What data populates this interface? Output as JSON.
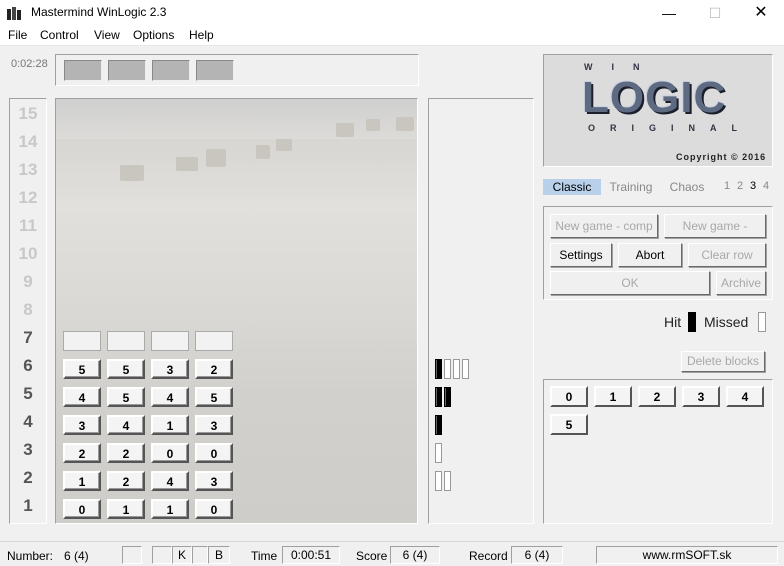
{
  "window": {
    "title": "Mastermind WinLogic 2.3",
    "minimize": "—",
    "maximize": "☐",
    "close": "✕"
  },
  "menu": [
    "File",
    "Control",
    "View",
    "Options",
    "Help"
  ],
  "timer": "0:02:28",
  "row_numbers": [
    "15",
    "14",
    "13",
    "12",
    "11",
    "10",
    "9",
    "8",
    "7",
    "6",
    "5",
    "4",
    "3",
    "2",
    "1"
  ],
  "active_rows": [
    "7",
    "6",
    "5",
    "4",
    "3",
    "2",
    "1"
  ],
  "guesses": [
    {
      "row": "6",
      "pegs": [
        "5",
        "5",
        "3",
        "2"
      ],
      "hits": 1,
      "missed": 3
    },
    {
      "row": "5",
      "pegs": [
        "4",
        "5",
        "4",
        "5"
      ],
      "hits": 2,
      "missed": 0
    },
    {
      "row": "4",
      "pegs": [
        "3",
        "4",
        "1",
        "3"
      ],
      "hits": 1,
      "missed": 0
    },
    {
      "row": "3",
      "pegs": [
        "2",
        "2",
        "0",
        "0"
      ],
      "hits": 0,
      "missed": 1
    },
    {
      "row": "2",
      "pegs": [
        "1",
        "2",
        "4",
        "3"
      ],
      "hits": 0,
      "missed": 2
    },
    {
      "row": "1",
      "pegs": [
        "0",
        "1",
        "1",
        "0"
      ],
      "hits": 0,
      "missed": 0
    }
  ],
  "logo": {
    "win": "WIN",
    "main": "LOGIC",
    "original": "ORIGINAL",
    "copyright": "Copyright © 2016"
  },
  "modes": {
    "classic": "Classic",
    "training": "Training",
    "chaos": "Chaos",
    "levels": [
      "1",
      "2",
      "3",
      "4"
    ],
    "selected_level": "3"
  },
  "controls": {
    "new_game_comp": "New game - comp",
    "new_game_player": "New game - player",
    "settings": "Settings",
    "abort": "Abort",
    "clear_row": "Clear row",
    "ok": "OK",
    "archive": "Archive",
    "delete_blocks": "Delete blocks"
  },
  "legend": {
    "hit": "Hit",
    "missed": "Missed"
  },
  "digits": [
    "0",
    "1",
    "2",
    "3",
    "4",
    "5"
  ],
  "status": {
    "number_label": "Number:",
    "number_value": "6 (4)",
    "k_label": "K",
    "b_label": "B",
    "time_label": "Time",
    "time_value": "0:00:51",
    "score_label": "Score",
    "score_value": "6 (4)",
    "record_label": "Record",
    "record_value": "6 (4)",
    "website": "www.rmSOFT.sk"
  },
  "colors": {
    "tab_selected": "#b9d0ea",
    "logo_text": "#5d6a82",
    "hit": "#000000",
    "missed": "#ffffff"
  }
}
